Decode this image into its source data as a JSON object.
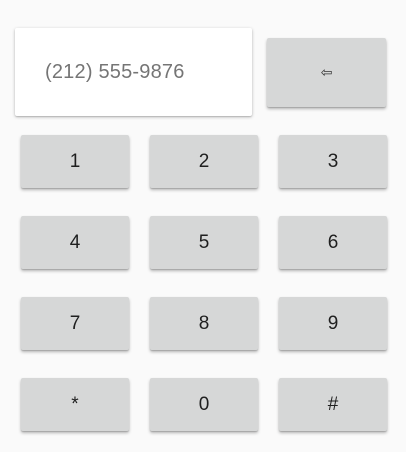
{
  "display": {
    "phone_number": "(212) 555-9876"
  },
  "backspace": {
    "icon": "backspace-arrow-icon",
    "glyph": "⇦"
  },
  "keypad": {
    "keys": [
      "1",
      "2",
      "3",
      "4",
      "5",
      "6",
      "7",
      "8",
      "9",
      "*",
      "0",
      "#"
    ]
  },
  "colors": {
    "background": "#fafafa",
    "key_background": "#d6d7d7",
    "display_background": "#ffffff",
    "display_text": "#757575",
    "key_text": "#1f1f1f"
  }
}
